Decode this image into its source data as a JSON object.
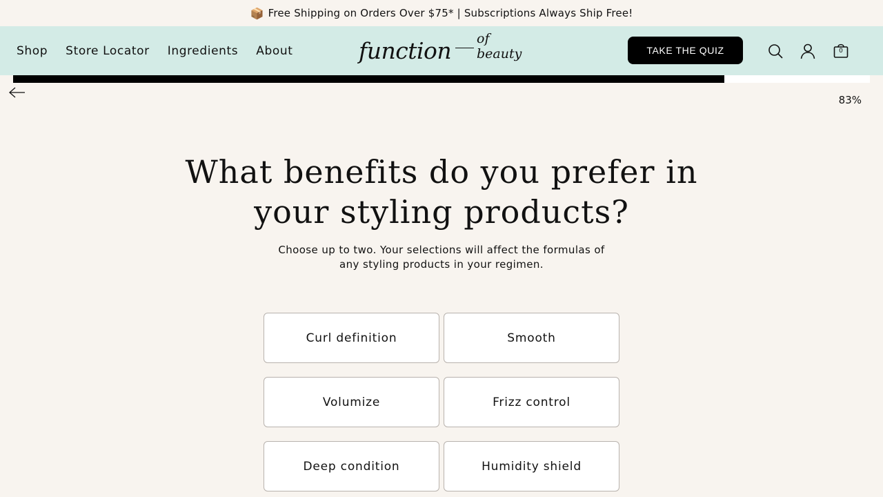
{
  "promo": {
    "icon": "package-icon",
    "text": "Free Shipping on Orders Over $75* | Subscriptions Always Ship Free!"
  },
  "header": {
    "background": "#d3ebe6",
    "nav": [
      "Shop",
      "Store Locator",
      "Ingredients",
      "About"
    ],
    "logo": {
      "main": "function",
      "secondary": "of beauty"
    },
    "quiz_button": "TAKE THE QUIZ",
    "icons": [
      "search-icon",
      "account-icon",
      "cart-icon"
    ],
    "cart_count": "0"
  },
  "progress": {
    "fraction": 0.83,
    "label": "83%"
  },
  "question": {
    "title": "What benefits do you prefer in your styling products?",
    "subtitle": "Choose up to two. Your selections will affect the formulas of any styling products in your regimen."
  },
  "options": [
    "Curl definition",
    "Smooth",
    "Volumize",
    "Frizz control",
    "Deep condition",
    "Humidity shield"
  ]
}
